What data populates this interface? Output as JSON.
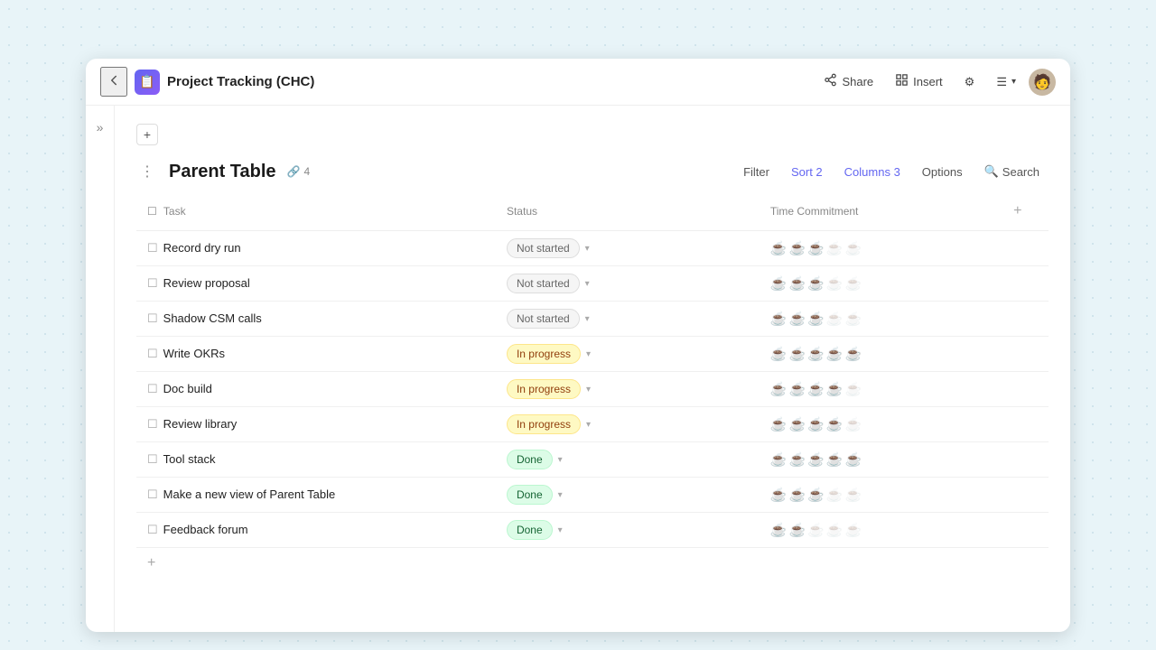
{
  "window": {
    "title": "Project Tracking (CHC)",
    "doc_icon": "📋"
  },
  "titlebar": {
    "back_label": "←",
    "share_label": "Share",
    "insert_label": "Insert",
    "settings_icon": "⚙",
    "menu_icon": "☰",
    "avatar_icon": "🧑"
  },
  "breadcrumb": {
    "add_icon": "+",
    "placeholder": ""
  },
  "sidebar": {
    "toggle_icon": "»"
  },
  "table": {
    "title": "Parent Table",
    "link_count": "4",
    "link_icon": "🔗",
    "toolbar": {
      "filter_label": "Filter",
      "sort_label": "Sort 2",
      "columns_label": "Columns 3",
      "options_label": "Options",
      "search_label": "Search",
      "search_icon": "🔍"
    },
    "columns": [
      {
        "id": "task",
        "label": "Task",
        "icon": "☐"
      },
      {
        "id": "status",
        "label": "Status"
      },
      {
        "id": "time",
        "label": "Time Commitment"
      }
    ],
    "rows": [
      {
        "task": "Record dry run",
        "status": "Not started",
        "status_type": "not-started",
        "coffee_filled": 3,
        "coffee_total": 5
      },
      {
        "task": "Review proposal",
        "status": "Not started",
        "status_type": "not-started",
        "coffee_filled": 3,
        "coffee_total": 5
      },
      {
        "task": "Shadow CSM calls",
        "status": "Not started",
        "status_type": "not-started",
        "coffee_filled": 3,
        "coffee_total": 5
      },
      {
        "task": "Write OKRs",
        "status": "In progress",
        "status_type": "in-progress",
        "coffee_filled": 5,
        "coffee_total": 5
      },
      {
        "task": "Doc build",
        "status": "In progress",
        "status_type": "in-progress",
        "coffee_filled": 4,
        "coffee_total": 5
      },
      {
        "task": "Review library",
        "status": "In progress",
        "status_type": "in-progress",
        "coffee_filled": 4,
        "coffee_total": 5
      },
      {
        "task": "Tool stack",
        "status": "Done",
        "status_type": "done",
        "coffee_filled": 5,
        "coffee_total": 5
      },
      {
        "task": "Make a new view of Parent Table",
        "status": "Done",
        "status_type": "done",
        "coffee_filled": 3,
        "coffee_total": 5
      },
      {
        "task": "Feedback forum",
        "status": "Done",
        "status_type": "done",
        "coffee_filled": 2,
        "coffee_total": 5
      }
    ],
    "add_row_icon": "+",
    "add_col_icon": "+"
  }
}
